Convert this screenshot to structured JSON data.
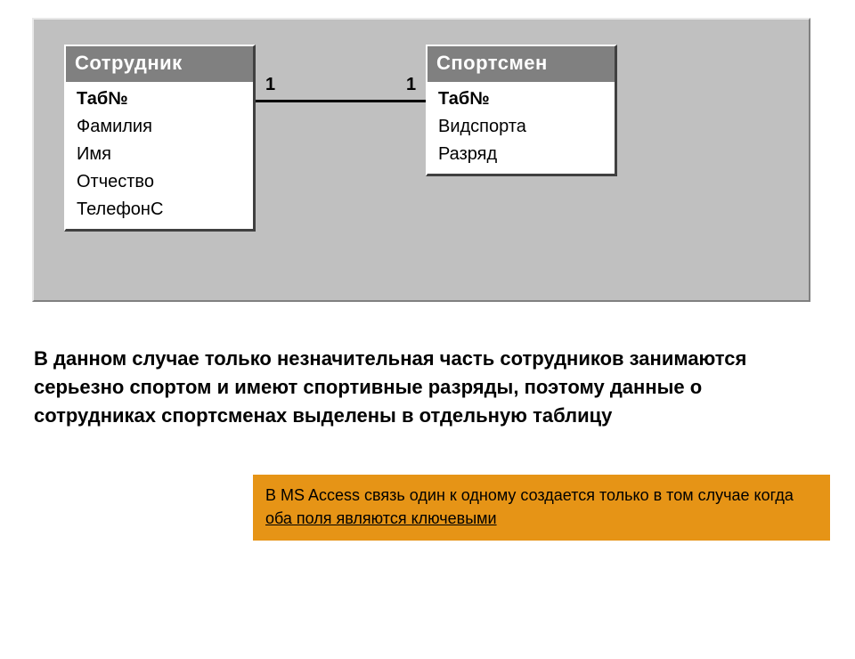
{
  "diagram": {
    "tables": {
      "left": {
        "title": "Сотрудник",
        "fields": [
          {
            "label": "Таб№",
            "key": true
          },
          {
            "label": "Фамилия",
            "key": false
          },
          {
            "label": "Имя",
            "key": false
          },
          {
            "label": "Отчество",
            "key": false
          },
          {
            "label": "ТелефонС",
            "key": false
          }
        ]
      },
      "right": {
        "title": "Спортсмен",
        "fields": [
          {
            "label": "Таб№",
            "key": true
          },
          {
            "label": "Видспорта",
            "key": false
          },
          {
            "label": "Разряд",
            "key": false
          }
        ]
      }
    },
    "relationship": {
      "left_label": "1",
      "right_label": "1"
    }
  },
  "paragraph": "В данном случае только незначительная часть сотрудников занимаются серьезно спортом и имеют спортивные разряды, поэтому данные о сотрудниках спортсменах выделены в отдельную таблицу",
  "note": {
    "prefix": "В MS Access связь один к одному создается только в том случае когда ",
    "underlined": "оба поля являются ключевыми"
  }
}
